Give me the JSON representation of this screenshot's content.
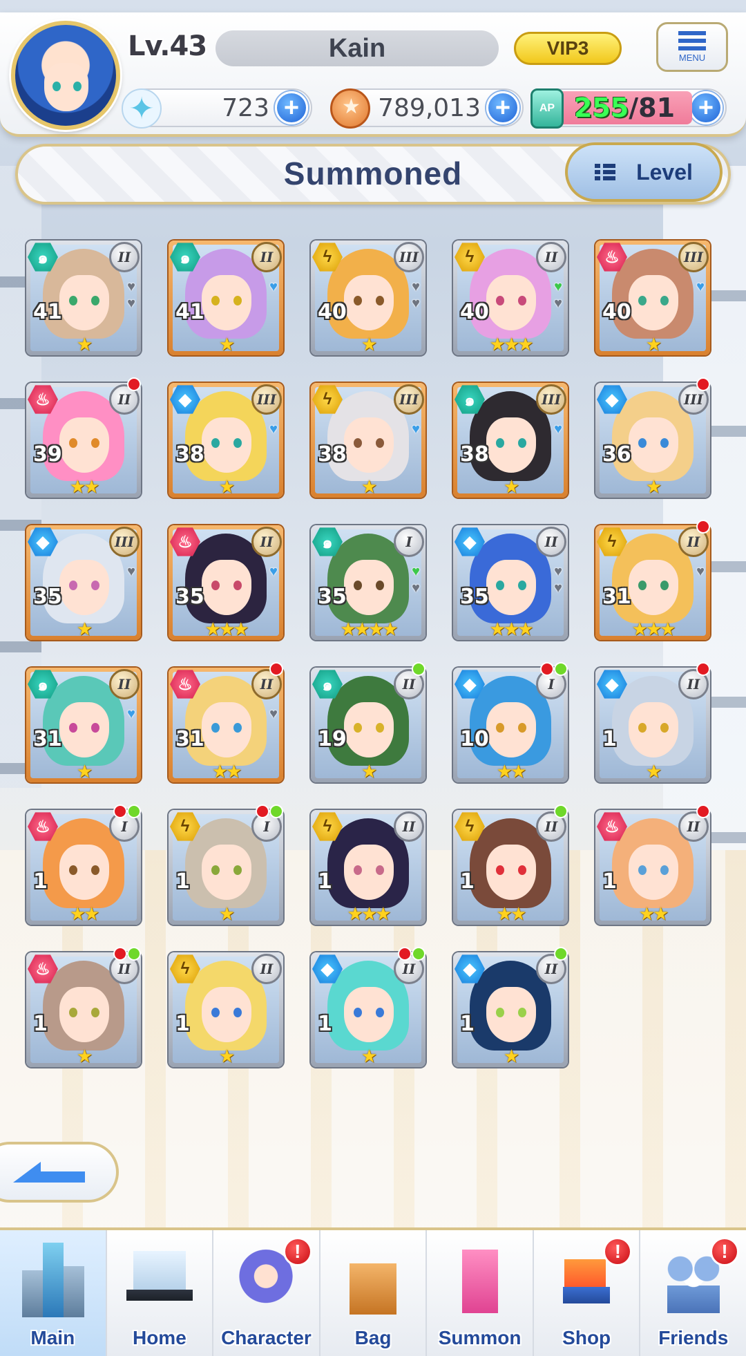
{
  "header": {
    "level": "Lv.43",
    "player_name": "Kain",
    "vip": "VIP3",
    "menu_label": "MENU",
    "gems": "723",
    "coins": "789,013",
    "ap_current": "255",
    "ap_max": "/81",
    "ap_icon_label": "AP"
  },
  "title": {
    "text": "Summoned",
    "sort_label": "Level"
  },
  "characters": [
    {
      "level": "41",
      "element": "wind",
      "rank": "II",
      "stars": "★",
      "frame": "silver",
      "hair": "#d8b89a",
      "eyes": "#3aa86b",
      "hearts": [
        "gray",
        "gray"
      ],
      "dots": []
    },
    {
      "level": "41",
      "element": "wind",
      "rank": "II",
      "stars": "★",
      "frame": "gold",
      "hair": "#c79be8",
      "eyes": "#d6b21e",
      "hearts": [
        "blue"
      ],
      "dots": []
    },
    {
      "level": "40",
      "element": "thunder",
      "rank": "III",
      "stars": "★",
      "frame": "silver",
      "hair": "#f2b04a",
      "eyes": "#8a5a2a",
      "hearts": [
        "gray",
        "gray"
      ],
      "dots": []
    },
    {
      "level": "40",
      "element": "thunder",
      "rank": "II",
      "stars": "★★★",
      "frame": "silver",
      "hair": "#e7a0e3",
      "eyes": "#c84a7a",
      "hearts": [
        "green",
        "gray"
      ],
      "dots": []
    },
    {
      "level": "40",
      "element": "fire",
      "rank": "III",
      "stars": "★",
      "frame": "gold",
      "hair": "#c98a6e",
      "eyes": "#3aa88a",
      "hearts": [
        "blue"
      ],
      "dots": []
    },
    {
      "level": "39",
      "element": "fire",
      "rank": "II",
      "stars": "★★",
      "frame": "silver",
      "hair": "#ff8fc4",
      "eyes": "#e08a2a",
      "hearts": [],
      "dots": [
        "red"
      ]
    },
    {
      "level": "38",
      "element": "water",
      "rank": "III",
      "stars": "★",
      "frame": "gold",
      "hair": "#f4d55a",
      "eyes": "#2aa8a0",
      "hearts": [
        "blue"
      ],
      "dots": []
    },
    {
      "level": "38",
      "element": "thunder",
      "rank": "III",
      "stars": "★",
      "frame": "gold",
      "hair": "#e4e2e6",
      "eyes": "#8a5a3a",
      "hearts": [
        "blue"
      ],
      "dots": []
    },
    {
      "level": "38",
      "element": "wind",
      "rank": "III",
      "stars": "★",
      "frame": "gold",
      "hair": "#2e2a30",
      "eyes": "#2aa8a0",
      "hearts": [
        "blue"
      ],
      "dots": []
    },
    {
      "level": "36",
      "element": "water",
      "rank": "III",
      "stars": "★",
      "frame": "silver",
      "hair": "#f4cf8a",
      "eyes": "#3a8ad8",
      "hearts": [],
      "dots": [
        "red"
      ]
    },
    {
      "level": "35",
      "element": "water",
      "rank": "III",
      "stars": "★",
      "frame": "gold",
      "hair": "#dfe6f0",
      "eyes": "#c86ab0",
      "hearts": [
        "gray"
      ],
      "dots": []
    },
    {
      "level": "35",
      "element": "fire",
      "rank": "II",
      "stars": "★★★",
      "frame": "gold",
      "hair": "#2c2440",
      "eyes": "#c84a6a",
      "hearts": [
        "blue"
      ],
      "dots": []
    },
    {
      "level": "35",
      "element": "wind",
      "rank": "I",
      "stars": "★★★★",
      "frame": "silver",
      "hair": "#4e8a4e",
      "eyes": "#6a4a2a",
      "hearts": [
        "green",
        "gray"
      ],
      "dots": []
    },
    {
      "level": "35",
      "element": "water",
      "rank": "II",
      "stars": "★★★",
      "frame": "silver",
      "hair": "#3a6ad8",
      "eyes": "#2aa8a0",
      "hearts": [
        "gray",
        "gray"
      ],
      "dots": []
    },
    {
      "level": "31",
      "element": "thunder",
      "rank": "II",
      "stars": "★★★",
      "frame": "gold",
      "hair": "#f4c05a",
      "eyes": "#3a9a6a",
      "hearts": [
        "gray"
      ],
      "dots": [
        "red"
      ]
    },
    {
      "level": "31",
      "element": "wind",
      "rank": "II",
      "stars": "★",
      "frame": "gold",
      "hair": "#5ac8b8",
      "eyes": "#c84a9a",
      "hearts": [
        "blue"
      ],
      "dots": []
    },
    {
      "level": "31",
      "element": "fire",
      "rank": "II",
      "stars": "★★",
      "frame": "gold",
      "hair": "#f4d27a",
      "eyes": "#3a9ad8",
      "hearts": [
        "gray"
      ],
      "dots": [
        "red"
      ]
    },
    {
      "level": "19",
      "element": "wind",
      "rank": "II",
      "stars": "★",
      "frame": "silver",
      "hair": "#3e7a3e",
      "eyes": "#d8b22a",
      "hearts": [],
      "dots": [
        "green"
      ]
    },
    {
      "level": "10",
      "element": "water",
      "rank": "I",
      "stars": "★★",
      "frame": "silver",
      "hair": "#3a9ae0",
      "eyes": "#d89a2a",
      "hearts": [],
      "dots": [
        "red",
        "green"
      ]
    },
    {
      "level": "1",
      "element": "water",
      "rank": "II",
      "stars": "★",
      "frame": "silver",
      "hair": "#c8d4e4",
      "eyes": "#d8a82a",
      "hearts": [],
      "dots": [
        "red"
      ]
    },
    {
      "level": "1",
      "element": "fire",
      "rank": "I",
      "stars": "★★",
      "frame": "silver",
      "hair": "#f49a4a",
      "eyes": "#8a5a2a",
      "hearts": [],
      "dots": [
        "red",
        "green"
      ]
    },
    {
      "level": "1",
      "element": "thunder",
      "rank": "I",
      "stars": "★",
      "frame": "silver",
      "hair": "#cbbfae",
      "eyes": "#8aa83a",
      "hearts": [],
      "dots": [
        "red",
        "green"
      ]
    },
    {
      "level": "1",
      "element": "thunder",
      "rank": "II",
      "stars": "★★★",
      "frame": "silver",
      "hair": "#2a2448",
      "eyes": "#c86a8a",
      "hearts": [],
      "dots": []
    },
    {
      "level": "1",
      "element": "thunder",
      "rank": "II",
      "stars": "★★",
      "frame": "silver",
      "hair": "#7a4a3a",
      "eyes": "#e0303a",
      "hearts": [],
      "dots": [
        "green"
      ]
    },
    {
      "level": "1",
      "element": "fire",
      "rank": "II",
      "stars": "★★",
      "frame": "silver",
      "hair": "#f4b07a",
      "eyes": "#5aa0d8",
      "hearts": [],
      "dots": [
        "red"
      ]
    },
    {
      "level": "1",
      "element": "fire",
      "rank": "II",
      "stars": "★",
      "frame": "silver",
      "hair": "#b89a8a",
      "eyes": "#a8a83a",
      "hearts": [],
      "dots": [
        "red",
        "green"
      ]
    },
    {
      "level": "1",
      "element": "thunder",
      "rank": "II",
      "stars": "★",
      "frame": "silver",
      "hair": "#f4d86a",
      "eyes": "#3a7ad8",
      "hearts": [],
      "dots": []
    },
    {
      "level": "1",
      "element": "water",
      "rank": "II",
      "stars": "★",
      "frame": "silver",
      "hair": "#5ad8d0",
      "eyes": "#3a7ad8",
      "hearts": [],
      "dots": [
        "red",
        "green"
      ]
    },
    {
      "level": "1",
      "element": "water",
      "rank": "II",
      "stars": "★",
      "frame": "silver",
      "hair": "#1a3a6a",
      "eyes": "#9ad04a",
      "hearts": [],
      "dots": [
        "green"
      ]
    }
  ],
  "element_icons": {
    "wind": "swirl-icon",
    "fire": "flame-icon",
    "thunder": "bolt-icon",
    "water": "droplet-icon"
  },
  "nav": {
    "items": [
      {
        "label": "Main",
        "icon": "building-icon",
        "alert": false,
        "active": true
      },
      {
        "label": "Home",
        "icon": "laptop-icon",
        "alert": false,
        "active": false
      },
      {
        "label": "Character",
        "icon": "character-icon",
        "alert": true,
        "active": false
      },
      {
        "label": "Bag",
        "icon": "bag-icon",
        "alert": false,
        "active": false
      },
      {
        "label": "Summon",
        "icon": "phone-icon",
        "alert": false,
        "active": false
      },
      {
        "label": "Shop",
        "icon": "cart-icon",
        "alert": true,
        "active": false
      },
      {
        "label": "Friends",
        "icon": "friends-icon",
        "alert": true,
        "active": false
      }
    ],
    "alert_glyph": "!"
  },
  "colors": {
    "accent_gold": "#d9c48a",
    "primary_blue": "#1f63d6",
    "title_navy": "#34446e",
    "ap_green": "#39ff55"
  }
}
